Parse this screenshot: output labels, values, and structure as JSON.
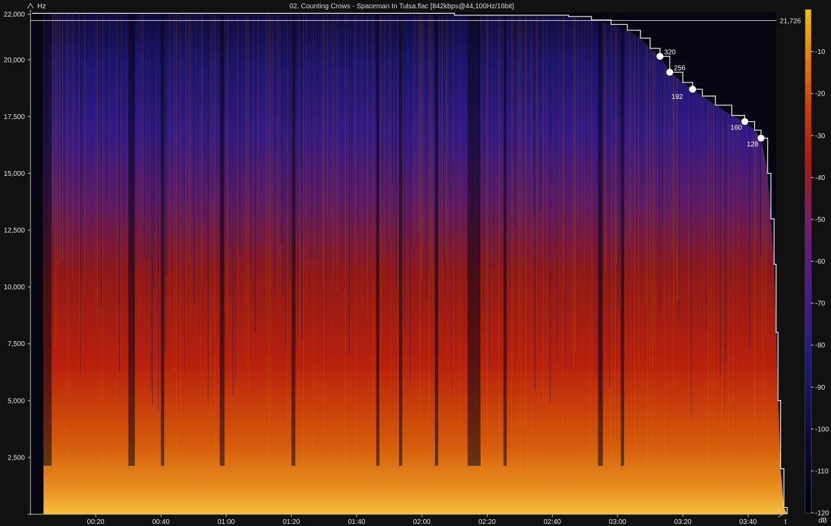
{
  "chart_data": {
    "type": "heatmap",
    "title": "02. Counting Crows - Spaceman In Tulsa.flac [842kbps@44,100Hz/16bit]",
    "ylabel": "Hz",
    "xlabel": "t",
    "y_range": [
      0,
      22050
    ],
    "x_range_seconds": [
      0,
      232
    ],
    "y_ticks": [
      {
        "value": 2500,
        "label": "2,500"
      },
      {
        "value": 5000,
        "label": "5,000"
      },
      {
        "value": 7500,
        "label": "7,500"
      },
      {
        "value": 10000,
        "label": "10,000"
      },
      {
        "value": 12500,
        "label": "12,500"
      },
      {
        "value": 15000,
        "label": "15,000"
      },
      {
        "value": 17500,
        "label": "17,500"
      },
      {
        "value": 20000,
        "label": "20,000"
      },
      {
        "value": 22000,
        "label": "22,000"
      }
    ],
    "x_ticks": [
      {
        "value": 20,
        "label": "00:20"
      },
      {
        "value": 40,
        "label": "00:40"
      },
      {
        "value": 60,
        "label": "01:00"
      },
      {
        "value": 80,
        "label": "01:20"
      },
      {
        "value": 100,
        "label": "01:40"
      },
      {
        "value": 120,
        "label": "02:00"
      },
      {
        "value": 140,
        "label": "02:20"
      },
      {
        "value": 160,
        "label": "02:40"
      },
      {
        "value": 180,
        "label": "03:00"
      },
      {
        "value": 200,
        "label": "03:20"
      },
      {
        "value": 220,
        "label": "03:40"
      }
    ],
    "colorbar": {
      "label": "dB",
      "range": [
        -120,
        0
      ],
      "ticks": [
        -10,
        -20,
        -30,
        -40,
        -50,
        -60,
        -70,
        -80,
        -90,
        -100,
        -110,
        -120
      ]
    },
    "reference_line": {
      "value": 21726,
      "label": "21,726"
    },
    "cutoff_curve": [
      {
        "t": 0.5,
        "hz": 22040
      },
      {
        "t": 130,
        "hz": 21960
      },
      {
        "t": 165,
        "hz": 21900
      },
      {
        "t": 172,
        "hz": 21750
      },
      {
        "t": 178,
        "hz": 21550
      },
      {
        "t": 183,
        "hz": 21300
      },
      {
        "t": 187,
        "hz": 20950
      },
      {
        "t": 190,
        "hz": 20500
      },
      {
        "t": 193,
        "hz": 20150
      },
      {
        "t": 196,
        "hz": 19450
      },
      {
        "t": 200,
        "hz": 19000
      },
      {
        "t": 203,
        "hz": 18700
      },
      {
        "t": 206,
        "hz": 18400
      },
      {
        "t": 210,
        "hz": 18000
      },
      {
        "t": 215,
        "hz": 17550
      },
      {
        "t": 219,
        "hz": 17280
      },
      {
        "t": 222,
        "hz": 16900
      },
      {
        "t": 224,
        "hz": 16550
      },
      {
        "t": 226,
        "hz": 15000
      },
      {
        "t": 227,
        "hz": 13000
      },
      {
        "t": 228,
        "hz": 11000
      },
      {
        "t": 228.6,
        "hz": 8000
      },
      {
        "t": 229.2,
        "hz": 5000
      },
      {
        "t": 230,
        "hz": 2000
      },
      {
        "t": 231,
        "hz": 300
      },
      {
        "t": 232,
        "hz": 0
      }
    ],
    "bitrate_markers": [
      {
        "label": "320",
        "t": 193,
        "hz": 20150
      },
      {
        "label": "256",
        "t": 196,
        "hz": 19450
      },
      {
        "label": "192",
        "t": 203,
        "hz": 18700
      },
      {
        "label": "160",
        "t": 219,
        "hz": 17280
      },
      {
        "label": "128",
        "t": 224,
        "hz": 16550
      }
    ],
    "grid": false,
    "colors": {
      "background": "#111111",
      "axis": "#bfbfbf",
      "curve": "#e8e8e8",
      "text": "#e6e6e6",
      "palette": [
        "#000000",
        "#0a0a3a",
        "#1f1a80",
        "#4b1a90",
        "#7a1a70",
        "#b0160e",
        "#d23a00",
        "#e87a00",
        "#f0b000",
        "#f6e08a"
      ]
    }
  }
}
